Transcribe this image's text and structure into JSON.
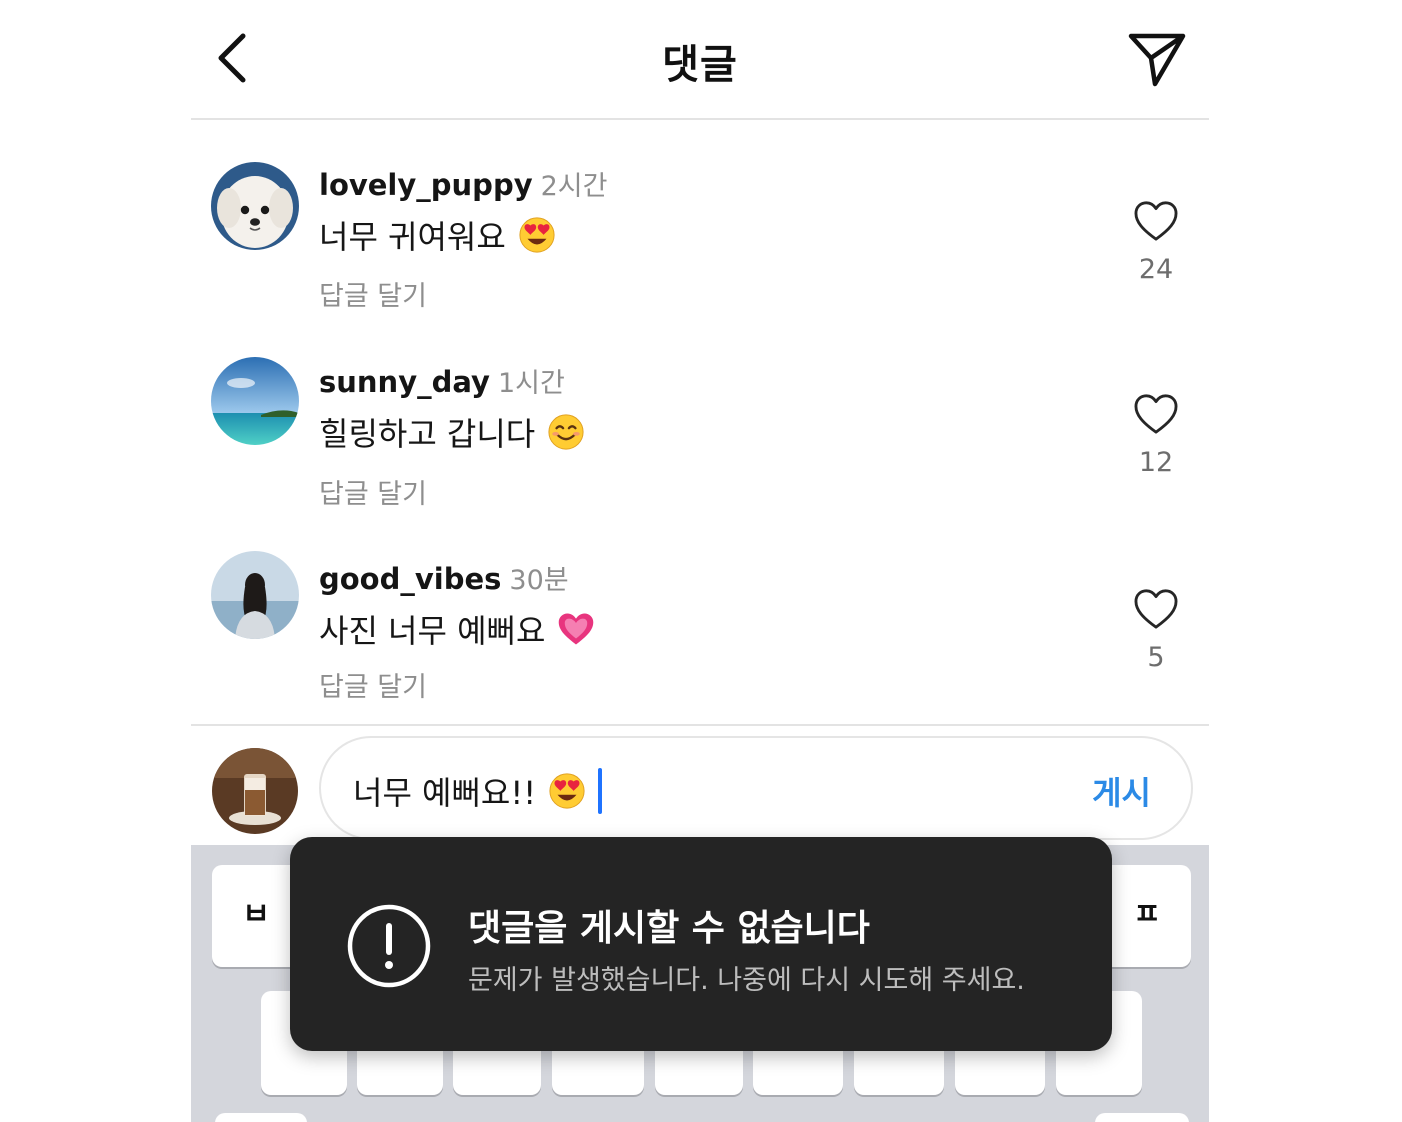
{
  "header": {
    "title": "댓글",
    "back_icon": "chevron-left-icon",
    "send_icon": "paper-plane-icon"
  },
  "comments": [
    {
      "username": "lovely_puppy",
      "time": "2시간",
      "text": "너무 귀여워요",
      "emoji": "heart-eyes-emoji",
      "reply_label": "답글 달기",
      "likes": "24",
      "avatar": "white-puppy-photo"
    },
    {
      "username": "sunny_day",
      "time": "1시간",
      "text": "힐링하고 갑니다",
      "emoji": "smiling-face-emoji",
      "reply_label": "답글 달기",
      "likes": "12",
      "avatar": "beach-ocean-photo"
    },
    {
      "username": "good_vibes",
      "time": "30분",
      "text": "사진 너무 예뻐요",
      "emoji": "pink-heart-emoji",
      "reply_label": "답글 달기",
      "likes": "5",
      "avatar": "woman-at-sea-photo"
    }
  ],
  "composer": {
    "avatar": "iced-coffee-photo",
    "text": "너무 예뻐요!!",
    "emoji": "heart-eyes-emoji",
    "post_label": "게시"
  },
  "keyboard": {
    "visible_keys": [
      "ㅂ",
      "ㅍ"
    ]
  },
  "toast": {
    "icon": "exclamation-circle-icon",
    "title": "댓글을 게시할 수 없습니다",
    "message": "문제가 발생했습니다. 나중에 다시 시도해 주세요."
  },
  "colors": {
    "accent": "#2b8ae6",
    "caret": "#1f73ff",
    "toast_bg": "#242424",
    "muted": "#8e8e8e",
    "keyboard_bg": "#d4d6dc"
  }
}
